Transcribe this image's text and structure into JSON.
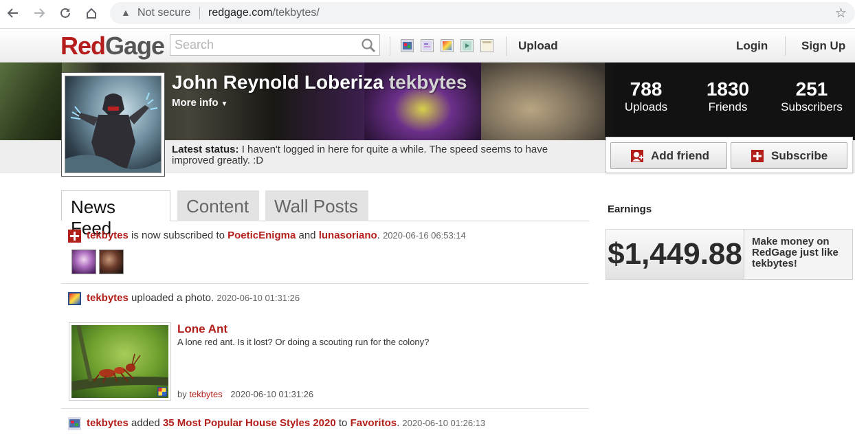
{
  "browser": {
    "security_label": "Not secure",
    "url_host": "redgage.com",
    "url_path": "/tekbytes/"
  },
  "header": {
    "logo_red": "Red",
    "logo_gray": "Gage",
    "search_placeholder": "Search",
    "upload_label": "Upload",
    "login_label": "Login",
    "signup_label": "Sign Up",
    "type_icons": [
      "photo-type-icon",
      "blog-type-icon",
      "image-type-icon",
      "video-type-icon",
      "document-type-icon"
    ]
  },
  "profile": {
    "full_name": "John Reynold Loberiza",
    "username": "tekbytes",
    "more_info_label": "More info",
    "stats": [
      {
        "value": "788",
        "label": "Uploads"
      },
      {
        "value": "1830",
        "label": "Friends"
      },
      {
        "value": "251",
        "label": "Subscribers"
      }
    ],
    "status_label": "Latest status:",
    "status_text": "I haven't logged in here for quite a while. The speed seems to have improved greatly. :D",
    "add_friend_label": "Add friend",
    "subscribe_label": "Subscribe"
  },
  "tabs": [
    {
      "label": "News Feed",
      "active": true
    },
    {
      "label": "Content",
      "active": false
    },
    {
      "label": "Wall Posts",
      "active": false
    }
  ],
  "feed": {
    "item1": {
      "actor": "tekbytes",
      "text1": "is now subscribed to",
      "target1": "PoeticEnigma",
      "and": "and",
      "target2": "lunasoriano",
      "period": ".",
      "timestamp": "2020-06-16 06:53:14"
    },
    "item2": {
      "actor": "tekbytes",
      "text": "uploaded a photo.",
      "timestamp": "2020-06-10 01:31:26",
      "photo_title": "Lone Ant",
      "photo_description": "A lone red ant. Is it lost? Or doing a scouting run for the colony?",
      "by_label": "by",
      "by_user": "tekbytes",
      "photo_timestamp": "2020-06-10 01:31:26"
    },
    "item3": {
      "actor": "tekbytes",
      "text1": "added",
      "target": "35 Most Popular House Styles 2020",
      "text2": "to",
      "collection": "Favoritos",
      "period": ".",
      "timestamp": "2020-06-10 01:26:13"
    }
  },
  "earnings": {
    "title": "Earnings",
    "amount": "$1,449.88",
    "promo": "Make money on RedGage just like tekbytes!"
  },
  "colors": {
    "brand_red": "#b3201b",
    "banner_overlay": "#141414"
  }
}
